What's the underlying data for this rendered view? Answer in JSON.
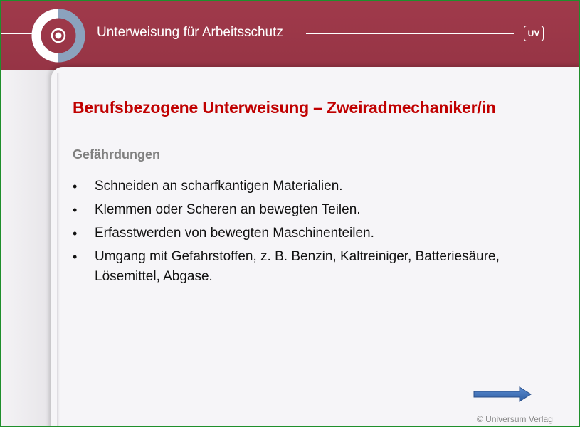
{
  "header": {
    "title": "Unterweisung für Arbeitsschutz",
    "badge": "UV"
  },
  "slide": {
    "title": "Berufsbezogene Unterweisung – Zweiradmechaniker/in",
    "section_heading": "Gefährdungen",
    "bullets": [
      "Schneiden an scharfkantigen Materialien.",
      "Klemmen oder Scheren an bewegten Teilen.",
      "Erfasstwerden von bewegten Maschinenteilen.",
      "Umgang mit Gefahrstoffen, z. B. Benzin, Kaltreiniger, Batteriesäure, Lösemittel, Abgase."
    ],
    "bullet_symbol": "•"
  },
  "footer": {
    "copyright": "© Universum Verlag"
  },
  "colors": {
    "header_bg": "#9e3a4b",
    "title_red": "#c00000",
    "heading_gray": "#7f7f7f",
    "arrow_blue": "#3d6fb6"
  },
  "icons": {
    "logo": "logo-ring-icon",
    "next": "arrow-right-icon"
  }
}
